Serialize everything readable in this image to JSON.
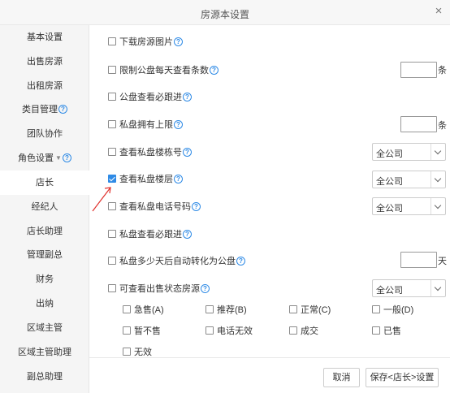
{
  "dialog": {
    "title": "房源本设置",
    "close": "×"
  },
  "sidebar": {
    "items": [
      {
        "label": "基本设置"
      },
      {
        "label": "出售房源"
      },
      {
        "label": "出租房源"
      },
      {
        "label": "类目管理"
      },
      {
        "label": "团队协作"
      },
      {
        "label": "角色设置"
      },
      {
        "label": "店长"
      },
      {
        "label": "经纪人"
      },
      {
        "label": "店长助理"
      },
      {
        "label": "管理副总"
      },
      {
        "label": "财务"
      },
      {
        "label": "出纳"
      },
      {
        "label": "区域主管"
      },
      {
        "label": "区域主管助理"
      },
      {
        "label": "副总助理"
      }
    ],
    "active": "店长"
  },
  "settings": [
    {
      "label": "下载房源图片",
      "checked": false
    },
    {
      "label": "限制公盘每天查看条数",
      "checked": false,
      "unit": "条",
      "value": ""
    },
    {
      "label": "公盘查看必跟进",
      "checked": false
    },
    {
      "label": "私盘拥有上限",
      "checked": false,
      "unit": "条",
      "value": ""
    },
    {
      "label": "查看私盘楼栋号",
      "checked": false,
      "select": "全公司"
    },
    {
      "label": "查看私盘楼层",
      "checked": true,
      "select": "全公司"
    },
    {
      "label": "查看私盘电话号码",
      "checked": false,
      "select": "全公司"
    },
    {
      "label": "私盘查看必跟进",
      "checked": false
    },
    {
      "label": "私盘多少天后自动转化为公盘",
      "checked": false,
      "unit": "天",
      "value": ""
    },
    {
      "label": "可查看出售状态房源",
      "checked": false,
      "select": "全公司"
    }
  ],
  "statuses": [
    {
      "label": "急售(A)",
      "checked": false
    },
    {
      "label": "推荐(B)",
      "checked": false
    },
    {
      "label": "正常(C)",
      "checked": false
    },
    {
      "label": "一般(D)",
      "checked": false
    },
    {
      "label": "暂不售",
      "checked": false
    },
    {
      "label": "电话无效",
      "checked": false
    },
    {
      "label": "成交",
      "checked": false
    },
    {
      "label": "已售",
      "checked": false
    },
    {
      "label": "无效",
      "checked": false
    }
  ],
  "footer": {
    "cancel": "取消",
    "save": "保存<店长>设置"
  },
  "colors": {
    "accent": "#2f8be6",
    "annotation_arrow": "#e0302c"
  },
  "icons": {
    "help": "help-question-icon",
    "expand": "caret-down-icon",
    "close": "close-icon"
  }
}
